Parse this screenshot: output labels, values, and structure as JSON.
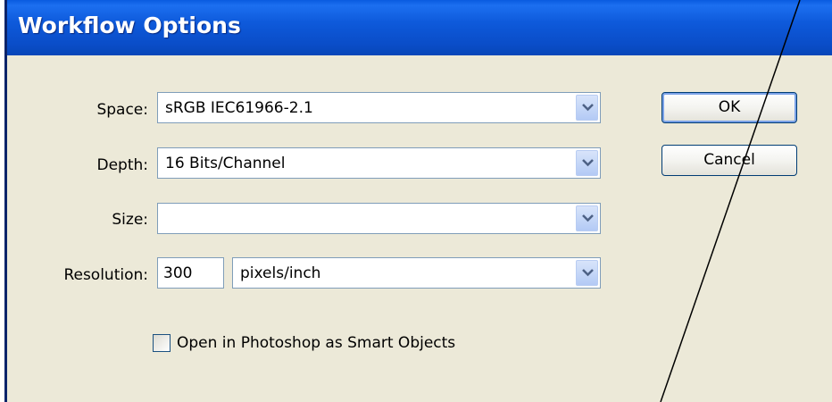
{
  "window": {
    "title": "Workflow Options"
  },
  "form": {
    "space": {
      "label": "Space:",
      "value": "sRGB IEC61966-2.1"
    },
    "depth": {
      "label": "Depth:",
      "value": "16 Bits/Channel"
    },
    "size": {
      "label": "Size:",
      "value": ""
    },
    "resolution": {
      "label": "Resolution:",
      "value": "300",
      "unit": "pixels/inch"
    },
    "smart_objects": {
      "label": "Open in Photoshop as Smart Objects",
      "checked": false
    }
  },
  "buttons": {
    "ok": "OK",
    "cancel": "Cancel"
  },
  "icons": {
    "dropdown": "chevron-down-icon"
  },
  "colors": {
    "titlebar": "#0A5BE0",
    "dialog_bg": "#ECE9D8",
    "border": "#7F9DB9"
  }
}
